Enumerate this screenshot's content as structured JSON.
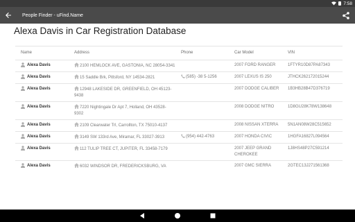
{
  "status_bar": {
    "time": "7:58",
    "icons": [
      "wifi-icon",
      "battery-icon"
    ]
  },
  "app_bar": {
    "title": "People Finder - uFind.Name",
    "back_icon": "arrow-back-icon",
    "share_icon": "share-icon"
  },
  "page": {
    "title": "Alexa Davis in Car Registration Database"
  },
  "table": {
    "headers": [
      "Name",
      "Address",
      "Phone",
      "Car Model",
      "VIN"
    ],
    "rows": [
      {
        "name": "Alexa Davis",
        "address": "2100 HEMLOCK AVE, GASTONIA, NC 28054-3341",
        "phone": "",
        "model": "2007 FORD RANGER",
        "vin": "1FTYR10D87PA87343"
      },
      {
        "name": "Alexa Davis",
        "address": "15 Saddle Brk, Pittsford, NY 14534-2821",
        "phone": "(585) -38 5-1256",
        "model": "2007 LEXUS IS 250",
        "vin": "JTHCK262172015244"
      },
      {
        "name": "Alexa Davis",
        "address": "12948 LAKESIDE DR, GREENFIELD, OH 45123-9438",
        "phone": "",
        "model": "2007 DODGE CALIBER",
        "vin": "1B3HB28B47D376719"
      },
      {
        "name": "Alexa Davis",
        "address": "7220 Nightingale Dr Apt 7, Holland, OH 43528-9302",
        "phone": "",
        "model": "2008 DODGE NITRO",
        "vin": "1D8GU28K78W138648"
      },
      {
        "name": "Alexa Davis",
        "address": "2109 Clearwater Trl, Carrollton, TX 75010-4137",
        "phone": "",
        "model": "2008 NISSAN XTERRA",
        "vin": "5N1AN08W28C515652"
      },
      {
        "name": "Alexa Davis",
        "address": "3149 SW 133rd Ave, Miramar, FL 33027-3913",
        "phone": "(954) 442-4763",
        "model": "2007 HONDA CIVIC",
        "vin": "1HGFA16827L094564"
      },
      {
        "name": "Alexa Davis",
        "address": "112 TULIP TREE CT, JUPITER, FL 33458-7179",
        "phone": "",
        "model": "2007 JEEP GRAND CHEROKEE",
        "vin": "1J8HS48P27C591214"
      },
      {
        "name": "Alexa Davis",
        "address": "6032 WINDSOR DR, FREDERICKSBURG, VA",
        "phone": "",
        "model": "2007 GMC SIERRA",
        "vin": "2GTEC13J271561368"
      }
    ]
  },
  "nav_bar": {
    "icons": [
      "back-triangle-icon",
      "home-circle-icon",
      "recents-square-icon"
    ]
  },
  "colors": {
    "app_bar": "#4a4a4a",
    "status_bar": "#3a3a3a",
    "nav_bar": "#000000",
    "icon_gray": "#aaaaaa"
  }
}
